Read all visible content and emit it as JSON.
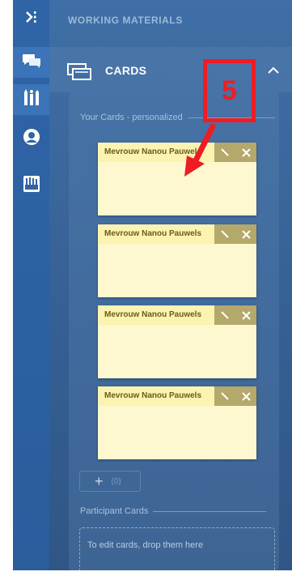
{
  "sidebar": {
    "items": [
      {
        "icon": "collapse-icon"
      },
      {
        "icon": "chat-icon"
      },
      {
        "icon": "tools-icon"
      },
      {
        "icon": "user-icon"
      },
      {
        "icon": "toolbox-icon"
      }
    ]
  },
  "panel": {
    "title": "WORKING MATERIALS",
    "cards_section": {
      "title": "CARDS",
      "your_cards_label": "Your Cards - personalized",
      "cards": [
        {
          "name": "Mevrouw Nanou Pauwels"
        },
        {
          "name": "Mevrouw Nanou Pauwels"
        },
        {
          "name": "Mevrouw Nanou Pauwels"
        },
        {
          "name": "Mevrouw Nanou Pauwels"
        }
      ],
      "add_button_label": "+",
      "add_count": "(0)",
      "participant_cards_label": "Participant Cards",
      "drop_hint": "To edit cards, drop them here"
    }
  },
  "annotation": {
    "step_number": "5",
    "color": "#ef1c24"
  },
  "colors": {
    "card_bg": "#fdf8cf",
    "card_header": "#fbf3b0",
    "card_tools": "#b4a86a"
  }
}
